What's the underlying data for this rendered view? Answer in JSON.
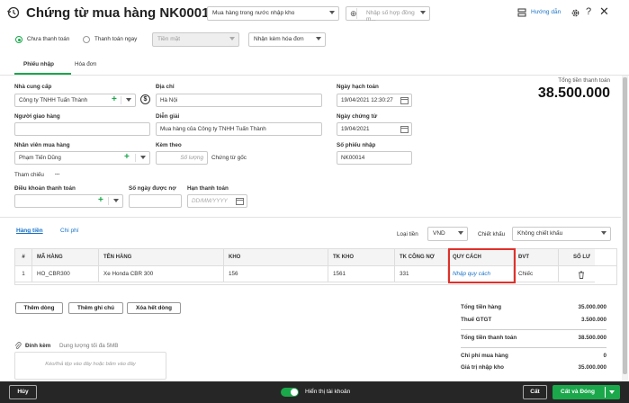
{
  "header": {
    "title": "Chứng từ mua hàng NK00014",
    "purchase_type": "Mua hàng trong nước nhập kho",
    "contract_placeholder": "Nhập số hợp đồng m...",
    "help_label": "Hướng dẫn"
  },
  "payment": {
    "unpaid_label": "Chưa thanh toán",
    "paid_now_label": "Thanh toán ngay",
    "method": "Tiền mặt",
    "invoice_option": "Nhận kèm hóa đơn"
  },
  "tabs": {
    "receipt": "Phiếu nhập",
    "invoice": "Hóa đơn"
  },
  "form": {
    "supplier_label": "Nhà cung cấp",
    "supplier_value": "Công ty TNHH Tuấn Thành",
    "address_label": "Địa chỉ",
    "address_value": "Hà Nội",
    "deliverer_label": "Người giao hàng",
    "description_label": "Diễn giải",
    "description_value": "Mua hàng của Công ty TNHH Tuấn Thành",
    "purchaser_label": "Nhân viên mua hàng",
    "purchaser_value": "Phạm Tiến Dũng",
    "attach_label": "Kèm theo",
    "attach_placeholder": "Số lượng",
    "attach_suffix": "Chứng từ gốc",
    "reference_label": "Tham chiếu",
    "reference_dots": "...",
    "terms_label": "Điều khoản thanh toán",
    "days_owed_label": "Số ngày được nợ",
    "due_label": "Hạn thanh toán",
    "due_placeholder": "DD/MM/YYYY",
    "posting_date_label": "Ngày hạch toán",
    "posting_date_value": "19/04/2021 12:30:27",
    "voucher_date_label": "Ngày chứng từ",
    "voucher_date_value": "19/04/2021",
    "voucher_no_label": "Số phiếu nhập",
    "voucher_no_value": "NK00014"
  },
  "total_box": {
    "label": "Tổng tiền thanh toán",
    "value": "38.500.000"
  },
  "detail": {
    "tab_goods": "Hàng tiền",
    "tab_cost": "Chi phí",
    "currency_label": "Loại tiền",
    "currency_value": "VND",
    "discount_label": "Chiết khấu",
    "discount_value": "Không chiết khấu"
  },
  "grid": {
    "headers": [
      "#",
      "MÃ HÀNG",
      "TÊN HÀNG",
      "KHO",
      "TK KHO",
      "TK CÔNG NỢ",
      "QUY CÁCH",
      "ĐVT",
      "SỐ LƯ"
    ],
    "row": {
      "no": "1",
      "code": "HO_CBR300",
      "name": "Xe Honda CBR 300",
      "warehouse": "156",
      "acc_wh": "1561",
      "acc_debt": "331",
      "spec": "Nhập quy cách",
      "unit": "Chiếc"
    }
  },
  "buttons": {
    "add_row": "Thêm dòng",
    "add_note": "Thêm ghi chú",
    "delete_all": "Xóa hết dòng"
  },
  "summary": [
    {
      "label": "Tổng tiền hàng",
      "value": "35.000.000"
    },
    {
      "label": "Thuế GTGT",
      "value": "3.500.000"
    },
    {
      "label": "Tổng tiền thanh toán",
      "value": "38.500.000"
    },
    {
      "label": "Chi phí mua hàng",
      "value": "0"
    },
    {
      "label": "Giá trị nhập kho",
      "value": "35.000.000"
    }
  ],
  "attachment": {
    "label": "Đính kèm",
    "hint": "Dung lượng tối đa 5MB",
    "drop_text": "Kéo/thả tệp vào đây hoặc bấm vào đây"
  },
  "footer": {
    "cancel": "Hủy",
    "show_account": "Hiển thị tài khoản",
    "save": "Cất",
    "save_add": "Cất và Đóng"
  },
  "colors": {
    "accent_green": "#1aa84b",
    "link_blue": "#1a73c7",
    "highlight_red": "#e0302a",
    "footer_bg": "#262626"
  }
}
